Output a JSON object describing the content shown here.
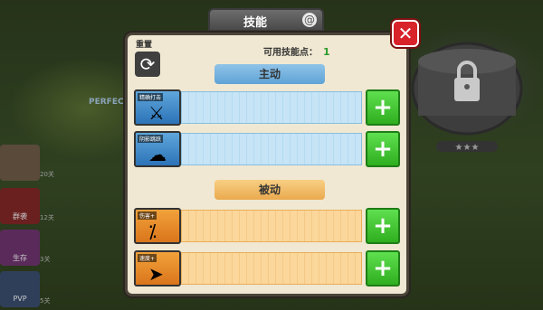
{
  "background": {
    "side_buttons": [
      {
        "label": "",
        "lock": "20关"
      },
      {
        "label": "群袭",
        "lock": "12关"
      },
      {
        "label": "生存",
        "lock": "3关"
      },
      {
        "label": "PVP",
        "lock": "5关"
      }
    ],
    "perfect_label": "PERFECT"
  },
  "title": "技能",
  "close_icon": "close-icon",
  "reset": {
    "label": "重置",
    "icon": "refresh-icon"
  },
  "points": {
    "label": "可用技能点：",
    "value": "1"
  },
  "sections": {
    "active": "主动",
    "passive": "被动"
  },
  "skills": {
    "active": [
      {
        "name": "精确打击",
        "icon": "sword-icon"
      },
      {
        "name": "阴影跳跃",
        "icon": "smoke-icon"
      }
    ],
    "passive": [
      {
        "name": "伤害+",
        "icon": "sword-percent-icon"
      },
      {
        "name": "速度+",
        "icon": "running-man-icon"
      }
    ]
  },
  "plus_label": "+",
  "colors": {
    "active_accent": "#5ea3d6",
    "passive_accent": "#eaa94e",
    "plus_green": "#2fae1f",
    "close_red": "#d8232a",
    "points_green": "#2c9a2c"
  }
}
